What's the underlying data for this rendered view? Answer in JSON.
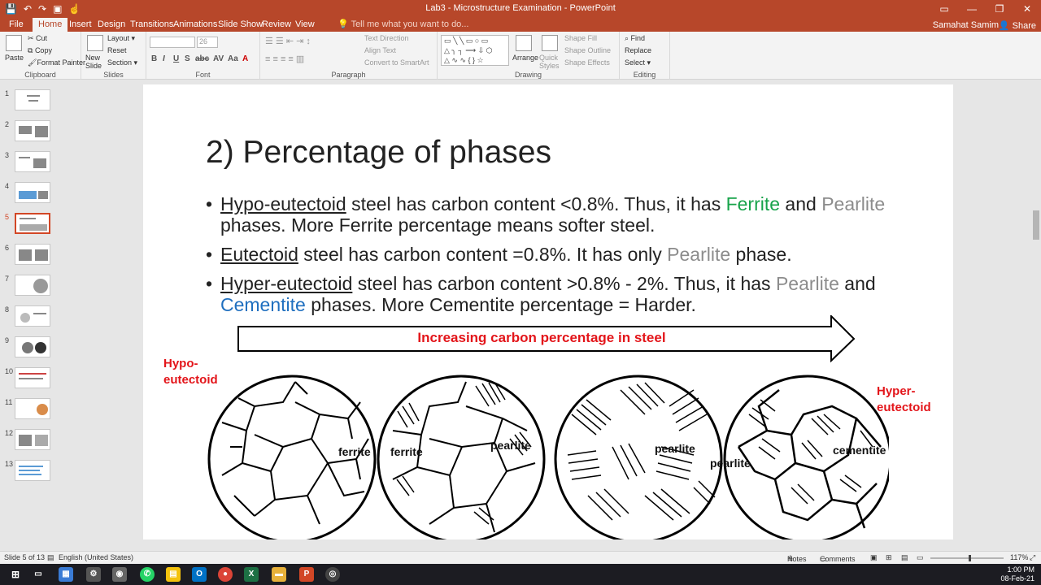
{
  "window": {
    "title": "Lab3 - Microstructure Examination - PowerPoint",
    "user": "Samahat Samim",
    "share": "Share",
    "controls": [
      "—",
      "❐",
      "✕"
    ]
  },
  "qat": {
    "icons": [
      "save-icon",
      "undo-icon",
      "redo-icon",
      "present-icon",
      "touch-icon"
    ]
  },
  "tabs": [
    "File",
    "Home",
    "Insert",
    "Design",
    "Transitions",
    "Animations",
    "Slide Show",
    "Review",
    "View"
  ],
  "active_tab": "Home",
  "tell_me": "Tell me what you want to do...",
  "ribbon": {
    "clipboard": {
      "paste": "Paste",
      "cut": "Cut",
      "copy": "Copy",
      "format_painter": "Format Painter",
      "label": "Clipboard"
    },
    "slides": {
      "new_slide": "New Slide",
      "layout": "Layout",
      "reset": "Reset",
      "section": "Section",
      "label": "Slides"
    },
    "font": {
      "size": "26",
      "label": "Font",
      "buttons": [
        "B",
        "I",
        "U",
        "S",
        "abc",
        "AV",
        "Aa"
      ]
    },
    "paragraph": {
      "text_direction": "Text Direction",
      "align_text": "Align Text",
      "convert_smartart": "Convert to SmartArt",
      "label": "Paragraph"
    },
    "drawing": {
      "arrange": "Arrange",
      "quick_styles": "Quick Styles",
      "shape_fill": "Shape Fill",
      "shape_outline": "Shape Outline",
      "shape_effects": "Shape Effects",
      "label": "Drawing"
    },
    "editing": {
      "find": "Find",
      "replace": "Replace",
      "select": "Select",
      "label": "Editing"
    }
  },
  "thumbnails": [
    "1",
    "2",
    "3",
    "4",
    "5",
    "6",
    "7",
    "8",
    "9",
    "10",
    "11",
    "12",
    "13"
  ],
  "selected_slide": 5,
  "slide": {
    "title": "2) Percentage of phases",
    "b1": {
      "term": "Hypo-eutectoid",
      "t1": " steel has carbon content <0.8%. Thus, it has ",
      "ferrite": "Ferrite",
      "t2": " and ",
      "pearlite": "Pearlite",
      "t3": " phases. More Ferrite percentage means softer steel."
    },
    "b2": {
      "term": "Eutectoid",
      "t1": " steel has carbon content =0.8%. It has only ",
      "pearlite": "Pearlite",
      "t2": " phase."
    },
    "b3": {
      "term": "Hyper-eutectoid",
      "t1": " steel has carbon content >0.8% - 2%. Thus, it has ",
      "pearlite": "Pearlite",
      "t2": " and ",
      "cementite": "Cementite",
      "t3": " phases. More Cementite percentage = Harder."
    },
    "arrow_text": "Increasing carbon percentage in steel",
    "label_hypo": [
      "Hypo-",
      "eutectoid"
    ],
    "label_hyper": [
      "Hyper-",
      "eutectoid"
    ],
    "micro_labels": {
      "ferrite1": "ferrite",
      "ferrite2": "ferrite",
      "pearlite1": "pearlite",
      "pearlite2": "pearlite",
      "pearlite3": "pearlite",
      "cementite": "cementite"
    }
  },
  "status": {
    "slide_of": "Slide 5 of 13",
    "language": "English (United States)",
    "notes": "Notes",
    "comments": "Comments",
    "zoom": "117%"
  },
  "taskbar": {
    "time": "1:00 PM",
    "date": "08-Feb-21"
  },
  "colors": {
    "ppt_accent": "#b7472a",
    "ferrite_green": "#17a34a",
    "pearlite_gray": "#8c8c8c",
    "cementite_blue": "#1f6fbf",
    "label_red": "#e3151a"
  }
}
